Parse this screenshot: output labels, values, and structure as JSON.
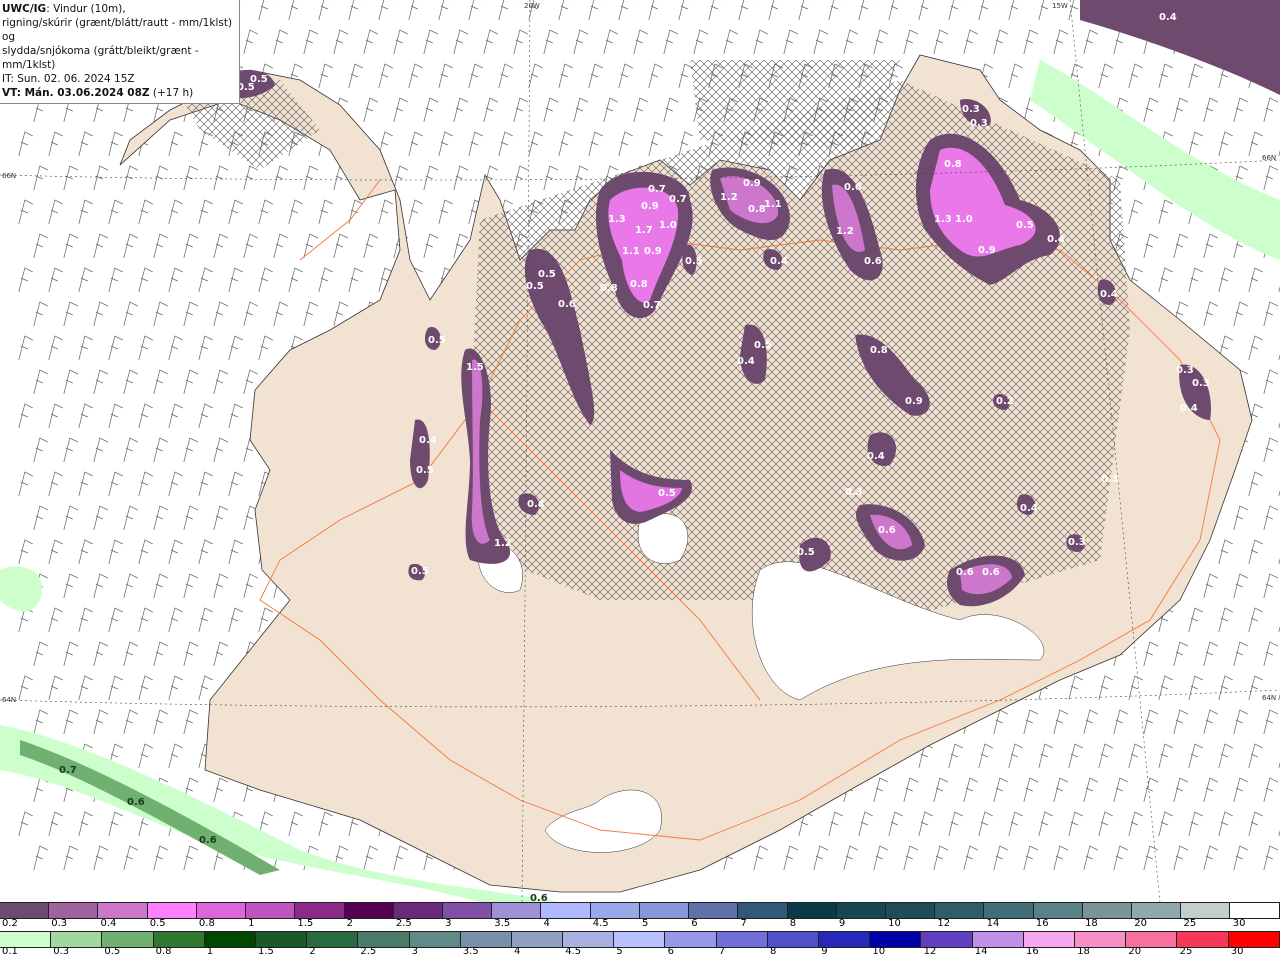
{
  "header": {
    "model": "UWC/IG",
    "line1": ": Vindur (10m),",
    "line2": "rigning/skúrir (grænt/blátt/rautt - mm/1klst) og",
    "line3": "slydda/snjókoma (grátt/bleikt/grænt - mm/1klst)",
    "issue_time": "IT: Sun. 02. 06. 2024 15Z",
    "valid_time": "VT: Mán. 03.06.2024 08Z",
    "lead_time": "(+17 h)"
  },
  "grid_labels": {
    "lon20": "20W",
    "lon15": "15W",
    "lat66_left": "66N",
    "lat66_right": "66N",
    "lat64_left": "64N",
    "lat64_right": "64N"
  },
  "map_colors": {
    "sea": "#ffffff",
    "land": "#f2e2d2",
    "roads": "#f07a3c",
    "hatch": "#555555"
  },
  "snow_labels": [
    "0.5",
    "0.5",
    "0.7",
    "0.9",
    "0.7",
    "1.3",
    "1.7",
    "1.0",
    "1.1",
    "0.9",
    "0.8",
    "0.7",
    "0.8",
    "0.5",
    "1.2",
    "0.9",
    "0.8",
    "1.1",
    "0.4",
    "0.6",
    "1.2",
    "0.6",
    "0.8",
    "1.3",
    "1.0",
    "0.5",
    "0.4",
    "0.9",
    "0.3",
    "0.3",
    "0.5",
    "0.5",
    "0.6",
    "0.4",
    "0.5",
    "0.4",
    "0.8",
    "0.9",
    "0.4",
    "0.5",
    "1.5",
    "0.4",
    "0.5",
    "0.4",
    "1.2",
    "0.5",
    "0.3",
    "0.6",
    "0.5",
    "0.6",
    "0.6",
    "0.3",
    "0.4",
    "0.3",
    "0.2",
    "0.3",
    "0.3",
    "0.4",
    "0.5"
  ],
  "rain_labels": [
    "0.7",
    "0.6",
    "0.6",
    "0.6",
    "0.4"
  ],
  "colorbar_snow": {
    "labels": [
      "0.2",
      "0.3",
      "0.4",
      "0.5",
      "0.8",
      "1",
      "1.5",
      "2",
      "2.5",
      "3",
      "3.5",
      "4",
      "4.5",
      "5",
      "6",
      "7",
      "8",
      "9",
      "10",
      "12",
      "14",
      "16",
      "18",
      "20",
      "25",
      "30"
    ],
    "colors": [
      "#6e4a6e",
      "#a062a0",
      "#cc77cc",
      "#ff80ff",
      "#dd66dd",
      "#c055c0",
      "#8b2a8b",
      "#550055",
      "#6a2a7a",
      "#8050a8",
      "#a090d8",
      "#b0b8ff",
      "#98a8e8",
      "#8896d8",
      "#6070a8",
      "#305878",
      "#0a3a48",
      "#154850",
      "#1e4c58",
      "#2e5c68",
      "#406e78",
      "#5a8088",
      "#7a9498",
      "#90a8a8",
      "#c4cece",
      "#ffffff"
    ]
  },
  "colorbar_rain": {
    "labels": [
      "0.1",
      "0.3",
      "0.5",
      "0.8",
      "1",
      "1.5",
      "2",
      "2.5",
      "3",
      "3.5",
      "4",
      "4.5",
      "5",
      "6",
      "7",
      "8",
      "9",
      "10",
      "12",
      "14",
      "16",
      "18",
      "20",
      "25",
      "30"
    ],
    "colors": [
      "#ccffcc",
      "#a0d8a0",
      "#70b070",
      "#307830",
      "#004800",
      "#1a5a28",
      "#2a6a40",
      "#4a7a68",
      "#608a88",
      "#7890a8",
      "#90a0c0",
      "#a8b0e0",
      "#b8c0ff",
      "#9898e8",
      "#7070d8",
      "#5050c8",
      "#2828b8",
      "#0000a8",
      "#6040c0",
      "#c090e8",
      "#f8a8f0",
      "#f890c8",
      "#f870a0",
      "#f83858",
      "#ff0000"
    ]
  }
}
